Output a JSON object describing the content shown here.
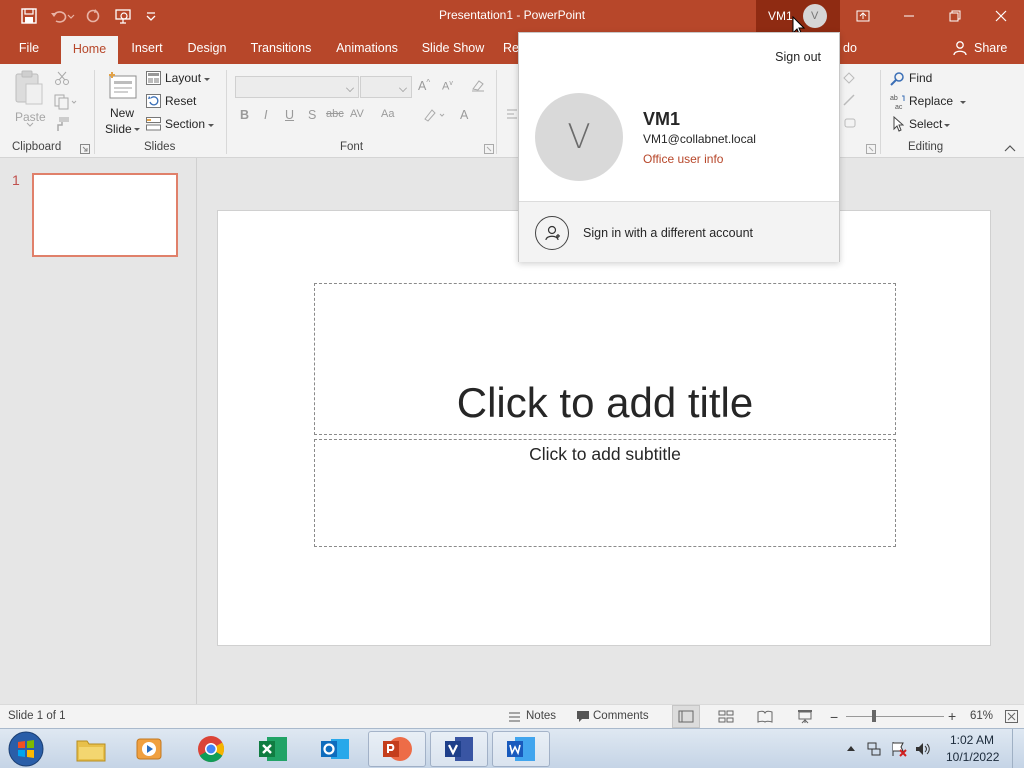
{
  "app": {
    "window_title": "Presentation1  -  PowerPoint",
    "account_label": "VM1",
    "account_initial": "V"
  },
  "tabs": [
    {
      "label": "File"
    },
    {
      "label": "Home",
      "active": true
    },
    {
      "label": "Insert"
    },
    {
      "label": "Design"
    },
    {
      "label": "Transitions"
    },
    {
      "label": "Animations"
    },
    {
      "label": "Slide Show"
    },
    {
      "label": "Re"
    },
    {
      "label": "do"
    }
  ],
  "share_label": "Share",
  "ribbon": {
    "clipboard": {
      "paste": "Paste",
      "group": "Clipboard"
    },
    "slides": {
      "new_slide_line1": "New",
      "new_slide_line2": "Slide",
      "layout": "Layout",
      "reset": "Reset",
      "section": "Section",
      "group": "Slides"
    },
    "font": {
      "group": "Font",
      "bold": "B",
      "italic": "I",
      "underline": "U",
      "shadow": "S",
      "strike": "abc",
      "spacing": "AV",
      "case": "Aa",
      "grow": "A",
      "shrink": "A",
      "color": "A"
    },
    "editing": {
      "find": "Find",
      "replace": "Replace",
      "select": "Select",
      "group": "Editing"
    }
  },
  "thumbnails": [
    {
      "number": "1"
    }
  ],
  "slide": {
    "title_placeholder": "Click to add title",
    "subtitle_placeholder": "Click to add subtitle"
  },
  "statusbar": {
    "slide_info": "Slide 1 of 1",
    "notes": "Notes",
    "comments": "Comments",
    "zoom": "61%"
  },
  "taskbar": {
    "time": "1:02 AM",
    "date": "10/1/2022"
  },
  "account_popup": {
    "sign_out": "Sign out",
    "initial": "V",
    "name": "VM1",
    "email": "VM1@collabnet.local",
    "info_link": "Office user info",
    "different_account": "Sign in with a different account"
  },
  "colors": {
    "brand": "#b7472a",
    "brand_dark": "#8f2b12",
    "ribbon_bg": "#f3f3f3",
    "thumb_border": "#e0806a"
  },
  "icons": [
    "save-icon",
    "undo-icon",
    "redo-icon",
    "present-icon",
    "customize-icon",
    "ribbon-display-icon",
    "minimize-icon",
    "restore-icon",
    "close-icon",
    "share-icon",
    "paste-icon",
    "cut-icon",
    "copy-icon",
    "format-painter-icon",
    "new-slide-icon",
    "layout-icon",
    "reset-icon",
    "section-icon",
    "find-icon",
    "replace-icon",
    "select-icon",
    "notes-icon",
    "comments-icon",
    "normal-view-icon",
    "sorter-view-icon",
    "reading-view-icon",
    "slideshow-view-icon",
    "fit-icon",
    "start-icon",
    "explorer-icon",
    "media-player-icon",
    "chrome-icon",
    "excel-icon",
    "outlook-icon",
    "powerpoint-icon",
    "visio-icon",
    "word-icon",
    "tray-arrow-icon",
    "network-icon",
    "flag-icon",
    "volume-icon",
    "add-person-icon",
    "cursor-icon"
  ]
}
